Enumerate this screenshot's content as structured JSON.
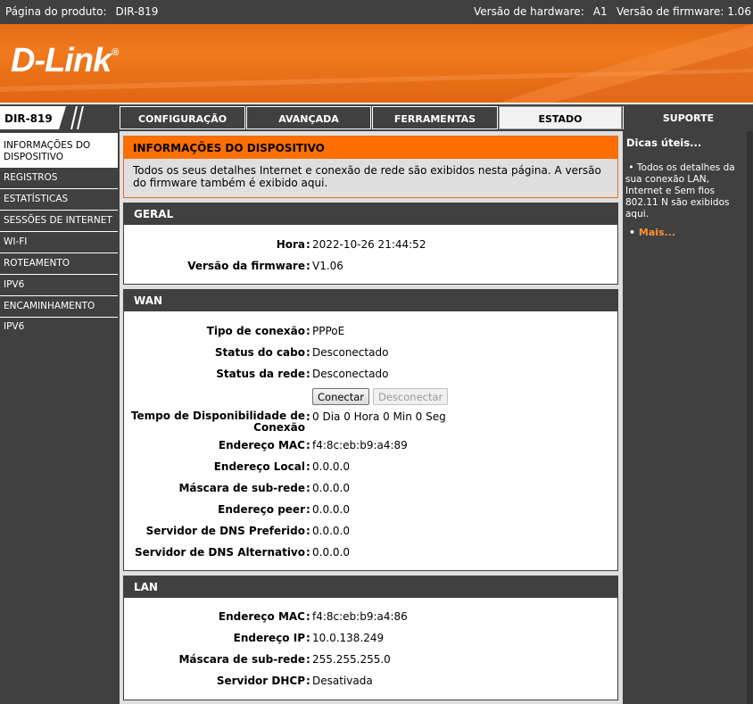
{
  "topbar": {
    "product_label": "Página do produto:",
    "product_value": "DIR-819",
    "hw_label": "Versão de hardware:",
    "hw_value": "A1",
    "fw_label": "Versão de firmware:",
    "fw_value": "1.06"
  },
  "brand": {
    "logo": "D-Link",
    "reg": "®"
  },
  "model": "DIR-819",
  "tabs": [
    {
      "label": "CONFIGURAÇÃO"
    },
    {
      "label": "AVANÇADA"
    },
    {
      "label": "FERRAMENTAS"
    },
    {
      "label": "ESTADO"
    },
    {
      "label": "SUPORTE"
    }
  ],
  "sidebar": {
    "items": [
      {
        "label": "INFORMAÇÕES DO DISPOSITIVO"
      },
      {
        "label": "REGISTROS"
      },
      {
        "label": "ESTATÍSTICAS"
      },
      {
        "label": "SESSÕES DE INTERNET"
      },
      {
        "label": "WI-FI"
      },
      {
        "label": "ROTEAMENTO"
      },
      {
        "label": "IPV6"
      },
      {
        "label": "ENCAMINHAMENTO IPV6"
      }
    ]
  },
  "info": {
    "title": "INFORMAÇÕES DO DISPOSITIVO",
    "text": "Todos os seus detalhes Internet e conexão de rede são exibidos nesta página. A versão do firmware também é exibido aqui."
  },
  "geral": {
    "title": "GERAL",
    "rows": [
      {
        "label": "Hora",
        "value": "2022-10-26 21:44:52"
      },
      {
        "label": "Versão da firmware",
        "value": "V1.06"
      }
    ]
  },
  "wan": {
    "title": "WAN",
    "rows_top": [
      {
        "label": "Tipo de conexão",
        "value": "PPPoE"
      },
      {
        "label": "Status do cabo",
        "value": "Desconectado"
      },
      {
        "label": "Status da rede",
        "value": "Desconectado"
      }
    ],
    "connect_label": "Conectar",
    "disconnect_label": "Desconectar",
    "uptime_label_1": "Tempo de Disponibilidade de",
    "uptime_label_2": "Conexão",
    "uptime_value": "0 Dia 0 Hora 0 Min 0 Seg",
    "rows_bottom": [
      {
        "label": "Endereço MAC",
        "value": "f4:8c:eb:b9:a4:89"
      },
      {
        "label": "Endereço Local",
        "value": "0.0.0.0"
      },
      {
        "label": "Máscara de sub-rede",
        "value": "0.0.0.0"
      },
      {
        "label": "Endereço peer",
        "value": "0.0.0.0"
      },
      {
        "label": "Servidor de DNS Preferido",
        "value": "0.0.0.0"
      },
      {
        "label": "Servidor de DNS Alternativo",
        "value": "0.0.0.0"
      }
    ]
  },
  "lan": {
    "title": "LAN",
    "rows": [
      {
        "label": "Endereço MAC",
        "value": "f4:8c:eb:b9:a4:86"
      },
      {
        "label": "Endereço IP",
        "value": "10.0.138.249"
      },
      {
        "label": "Máscara de sub-rede",
        "value": "255.255.255.0"
      },
      {
        "label": "Servidor DHCP",
        "value": "Desativada"
      }
    ]
  },
  "hints": {
    "title": "Dicas úteis...",
    "bullet": "•",
    "text": "Todos os detalhes da sua conexão LAN, Internet e Sem fios 802.11 N são exibidos aqui.",
    "more": "Mais..."
  },
  "colors": {
    "accent": "#ff6f00",
    "dark": "#404040"
  }
}
